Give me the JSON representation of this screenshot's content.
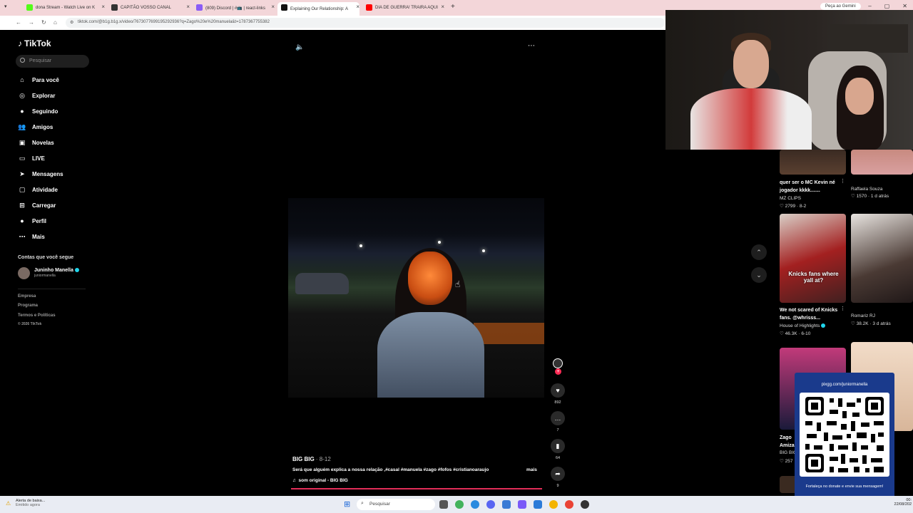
{
  "browser": {
    "tabs": [
      {
        "label": "dona Stream - Watch Live on K",
        "color": "#53fc18"
      },
      {
        "label": "CAPITÃO VOSSO CANAL",
        "color": "#333333"
      },
      {
        "label": "(809) Discord | #📺 | react-links",
        "color": "#8a5cf6"
      },
      {
        "label": "Explaining Our Relationship: A",
        "color": "#111111"
      },
      {
        "label": "DIA DE GUERRA! TRAIRA AQUI",
        "color": "#ff0000"
      }
    ],
    "new_tab": "+",
    "gemini_label": "Peça ao Gemini",
    "url": "tiktok.com/@b1g.b1g.x/video/7673077699195292936?q=Zago%20e%20manuela&t=1787367755382"
  },
  "sidebar": {
    "logo": "TikTok",
    "search_placeholder": "Pesquisar",
    "items": [
      {
        "label": "Para você",
        "icon": "home-icon",
        "glyph": "⌂"
      },
      {
        "label": "Explorar",
        "icon": "compass-icon",
        "glyph": "◎"
      },
      {
        "label": "Seguindo",
        "icon": "following-avatar-icon",
        "glyph": "●"
      },
      {
        "label": "Amigos",
        "icon": "friends-icon",
        "glyph": "👥"
      },
      {
        "label": "Novelas",
        "icon": "novelas-icon",
        "glyph": "▣"
      },
      {
        "label": "LIVE",
        "icon": "live-icon",
        "glyph": "▭"
      },
      {
        "label": "Mensagens",
        "icon": "messages-icon",
        "glyph": "➤"
      },
      {
        "label": "Atividade",
        "icon": "activity-icon",
        "glyph": "▢"
      },
      {
        "label": "Carregar",
        "icon": "upload-icon",
        "glyph": "⊞"
      },
      {
        "label": "Perfil",
        "icon": "profile-icon",
        "glyph": "●"
      },
      {
        "label": "Mais",
        "icon": "more-icon",
        "glyph": "⋯"
      }
    ],
    "following_header": "Contas que você segue",
    "following": [
      {
        "name": "Juninho Manella",
        "username": "juniormanella"
      }
    ],
    "footer": [
      "Empresa",
      "Programa",
      "Termos e Políticas",
      "© 2026 TikTok"
    ]
  },
  "video": {
    "author": "BIG BIG",
    "date": "· 8-12",
    "caption": "Será que alguém explica a nossa relação ,#casal #manuela #zago #fofos #cristianoaraujo",
    "more": "mais",
    "sound": "som original - BIG BIG",
    "progress": 1.0,
    "actions": [
      {
        "icon": "heart-icon",
        "glyph": "♥",
        "count": "892"
      },
      {
        "icon": "comment-icon",
        "glyph": "…",
        "count": "7"
      },
      {
        "icon": "bookmark-icon",
        "glyph": "▮",
        "count": "64"
      },
      {
        "icon": "share-icon",
        "glyph": "➦",
        "count": "9"
      }
    ]
  },
  "recommendations": [
    {
      "title": "quer ser o MC Kevin né jogador kkkk.......",
      "user": "MZ CLIPS",
      "stats": "♡ 2799 · 8-2"
    },
    {
      "title": "",
      "user": "Raffaela Souza",
      "stats": "♡ 1570 · 1 d atrás"
    },
    {
      "title": "We not scared of Knicks fans. @whrisss...",
      "user": "House of Highlights",
      "stats": "♡ 46.3K · 6-10",
      "overlay": "Knicks fans where yall at?"
    },
    {
      "title": "",
      "user": "Romariz RJ",
      "stats": "♡ 38.2K · 3 d atrás"
    },
    {
      "title": "Zago",
      "user": "BIG BIG",
      "stats": "♡ 257"
    },
    {
      "title": "Amiza",
      "user": "",
      "stats": ""
    }
  ],
  "qr": {
    "url": "pixgg.com/juniormanella",
    "message": "Fortaleça no donate e envie sua mensagem!"
  },
  "taskbar": {
    "alert_title": "Alerta de baixa...",
    "alert_sub": "Emitido agora",
    "search": "Pesquisar",
    "time": "00:",
    "date": "22/08/202"
  }
}
